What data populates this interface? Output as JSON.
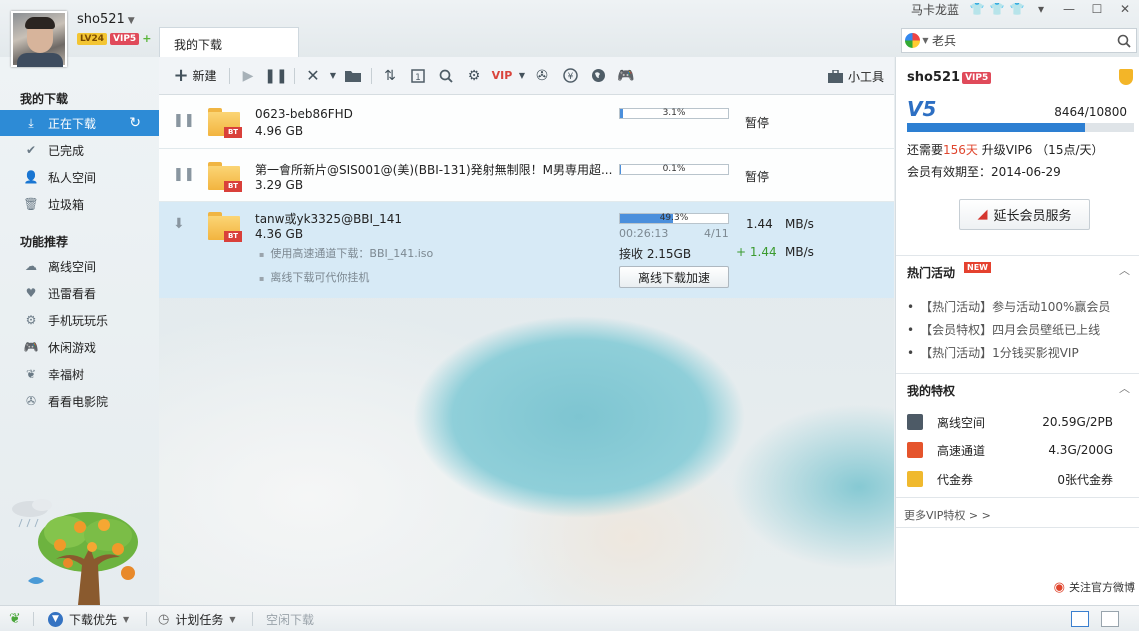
{
  "user": {
    "name": "sho521",
    "level": "LV24",
    "vip": "VIP5",
    "plus": "+"
  },
  "title_bar": {
    "skin_name": "马卡龙蓝",
    "minimize": "—",
    "maximize": "☐",
    "close": "✕",
    "menu": "▾"
  },
  "tabs": {
    "active": "我的下载"
  },
  "search": {
    "value": "老兵",
    "icon": "search-icon"
  },
  "sidebar": {
    "my_downloads_title": "我的下载",
    "items": [
      {
        "label": "正在下载",
        "icon": "download-icon"
      },
      {
        "label": "已完成",
        "icon": "check-icon"
      },
      {
        "label": "私人空间",
        "icon": "user-icon"
      },
      {
        "label": "垃圾箱",
        "icon": "trash-icon"
      }
    ],
    "featured_title": "功能推荐",
    "features": [
      {
        "label": "离线空间",
        "icon": "cloud-icon"
      },
      {
        "label": "迅雷看看",
        "icon": "heart-icon"
      },
      {
        "label": "手机玩玩乐",
        "icon": "gear-icon"
      },
      {
        "label": "休闲游戏",
        "icon": "gamepad-icon"
      },
      {
        "label": "幸福树",
        "icon": "leaf-icon"
      },
      {
        "label": "看看电影院",
        "icon": "film-icon"
      }
    ]
  },
  "toolbar": {
    "new_label": "新建",
    "small_tools_label": "小工具"
  },
  "downloads": [
    {
      "name": "0623-beb86FHD",
      "size": "4.96 GB",
      "progress_pct": 3.1,
      "progress_text": "3.1%",
      "status": "暂停"
    },
    {
      "name": "第一會所新片@SIS001@(美)(BBI-131)発射無制限！M男専用超...",
      "size": "3.29 GB",
      "progress_pct": 0.1,
      "progress_text": "0.1%",
      "status": "暂停"
    },
    {
      "name": "tanw或yk3325@BBI_141",
      "size": "4.36 GB",
      "progress_pct": 49.3,
      "progress_text": "49.3%",
      "time_left": "00:26:13",
      "segments": "4/11",
      "received": "接收 2.15GB",
      "speed": "1.44",
      "speed_unit": "MB/s",
      "accel_speed": "+ 1.44",
      "accel_unit": "MB/s",
      "note1": "使用高速通道下载：BBI_141.iso",
      "note2": "离线下载可代你挂机",
      "accel_button": "离线下载加速"
    }
  ],
  "vip_panel": {
    "name": "sho521",
    "vip_badge": "VIP5",
    "level_mark": "V5",
    "points": "8464/10800",
    "points_ratio": 0.784,
    "need_prefix": "还需要",
    "need_days": "156天",
    "need_suffix": "升级VIP6 （15点/天）",
    "expiry": "会员有效期至：2014-06-29",
    "renew_button": "延长会员服务",
    "hot_title": "热门活动",
    "hot_new": "NEW",
    "hot_items": [
      "【热门活动】参与活动100%赢会员",
      "【会员特权】四月会员壁纸已上线",
      "【热门活动】1分钱买影视VIP"
    ],
    "priv_title": "我的特权",
    "privileges": [
      {
        "label": "离线空间",
        "value": "20.59G/2PB",
        "color": "#4d5a66"
      },
      {
        "label": "高速通道",
        "value": "4.3G/200G",
        "color": "#e5542c"
      },
      {
        "label": "代金券",
        "value": "0张代金券",
        "color": "#f0b92e"
      }
    ],
    "more_link": "更多VIP特权 > >",
    "weibo": "关注官方微博"
  },
  "statusbar": {
    "priority": "下载优先",
    "schedule": "计划任务",
    "idle": "空闲下载"
  }
}
